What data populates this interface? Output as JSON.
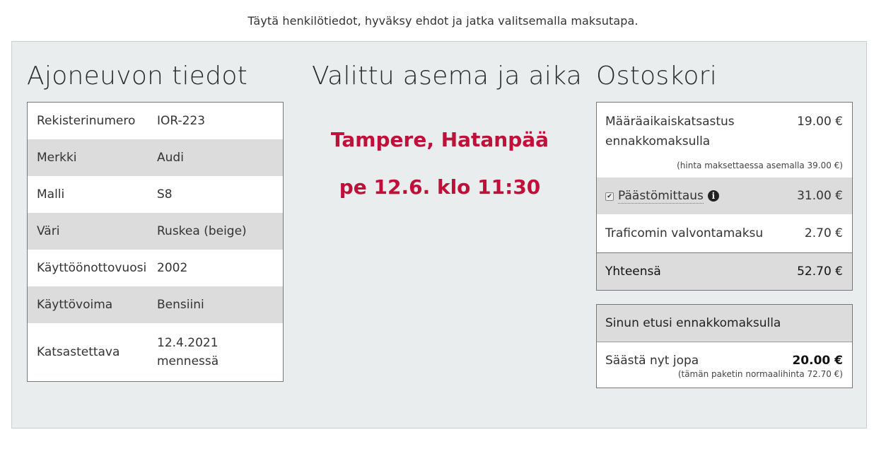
{
  "intro_text": "Täytä henkilötiedot, hyväksy ehdot ja jatka valitsemalla maksutapa.",
  "vehicle": {
    "title": "Ajoneuvon tiedot",
    "rows": [
      {
        "label": "Rekisterinumero",
        "value": "IOR-223"
      },
      {
        "label": "Merkki",
        "value": "Audi"
      },
      {
        "label": "Malli",
        "value": "S8"
      },
      {
        "label": "Väri",
        "value": "Ruskea (beige)"
      },
      {
        "label": "Käyttöönottovuosi",
        "value": "2002"
      },
      {
        "label": "Käyttövoima",
        "value": "Bensiini"
      },
      {
        "label": "Katsastettava",
        "value_line1": "12.4.2021",
        "value_line2": "mennessä"
      }
    ]
  },
  "station": {
    "title": "Valittu asema ja aika",
    "name": "Tampere, Hatanpää",
    "time": "pe 12.6. klo 11:30"
  },
  "cart": {
    "title": "Ostoskori",
    "main_item": {
      "name_line1": "Määräaikaiskatsastus",
      "name_line2": "ennakkomaksulla",
      "price": "19.00 €",
      "note": "(hinta maksettaessa asemalla 39.00 €)"
    },
    "emission": {
      "name": "Päästömittaus",
      "price": "31.00 €",
      "checked": true
    },
    "fee": {
      "name": "Traficomin valvontamaksu",
      "price": "2.70 €"
    },
    "total": {
      "label": "Yhteensä",
      "price": "52.70 €"
    }
  },
  "benefit": {
    "title": "Sinun etusi ennakkomaksulla",
    "label": "Säästä nyt jopa",
    "amount": "20.00 €",
    "note": "(tämän paketin normaalihinta 72.70 €)"
  },
  "colors": {
    "accent": "#c0103a",
    "panel_bg": "#e9edee",
    "row_alt": "#dcdcdc"
  }
}
